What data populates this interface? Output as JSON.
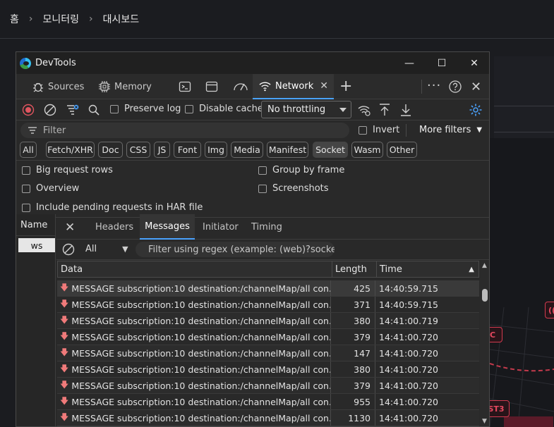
{
  "breadcrumb": {
    "home": "홈",
    "section": "모니터링",
    "page": "대시보드",
    "separator": "›"
  },
  "background_nodes": [
    {
      "label": "C"
    },
    {
      "label": "(("
    },
    {
      "label": "ST3"
    }
  ],
  "devtools": {
    "window_title": "DevTools",
    "window_buttons": {
      "minimize": "—",
      "maximize": "☐",
      "close": "✕"
    },
    "tabs": [
      {
        "label": "Sources"
      },
      {
        "label": "Memory"
      },
      {
        "label": "Network",
        "active": true
      }
    ],
    "toolbar": {
      "preserve_log": "Preserve log",
      "disable_cache": "Disable cache",
      "throttling": "No throttling"
    },
    "filter": {
      "placeholder": "Filter",
      "invert": "Invert",
      "more_filters": "More filters"
    },
    "chips": [
      "All",
      "Fetch/XHR",
      "Doc",
      "CSS",
      "JS",
      "Font",
      "Img",
      "Media",
      "Manifest",
      "Socket",
      "Wasm",
      "Other"
    ],
    "active_chip": "Socket",
    "options": {
      "big_request_rows": "Big request rows",
      "group_by_frame": "Group by frame",
      "overview": "Overview",
      "screenshots": "Screenshots",
      "include_pending": "Include pending requests in HAR file"
    },
    "name_column": {
      "header": "Name",
      "item": "ws"
    },
    "detail_tabs": [
      {
        "label": "Headers"
      },
      {
        "label": "Messages",
        "active": true
      },
      {
        "label": "Initiator"
      },
      {
        "label": "Timing"
      }
    ],
    "message_filter": {
      "type": "All",
      "regex_placeholder": "Filter using regex (example: (web)?socket"
    },
    "table": {
      "headers": {
        "data": "Data",
        "length": "Length",
        "time": "Time"
      },
      "rows": [
        {
          "data": "MESSAGE subscription:10 destination:/channelMap/all con...",
          "length": "425",
          "time": "14:40:59.715"
        },
        {
          "data": "MESSAGE subscription:10 destination:/channelMap/all con...",
          "length": "371",
          "time": "14:40:59.715"
        },
        {
          "data": "MESSAGE subscription:10 destination:/channelMap/all con...",
          "length": "380",
          "time": "14:41:00.719"
        },
        {
          "data": "MESSAGE subscription:10 destination:/channelMap/all con...",
          "length": "379",
          "time": "14:41:00.720"
        },
        {
          "data": "MESSAGE subscription:10 destination:/channelMap/all con...",
          "length": "147",
          "time": "14:41:00.720"
        },
        {
          "data": "MESSAGE subscription:10 destination:/channelMap/all con...",
          "length": "380",
          "time": "14:41:00.720"
        },
        {
          "data": "MESSAGE subscription:10 destination:/channelMap/all con...",
          "length": "379",
          "time": "14:41:00.720"
        },
        {
          "data": "MESSAGE subscription:10 destination:/channelMap/all con...",
          "length": "955",
          "time": "14:41:00.720"
        },
        {
          "data": "MESSAGE subscription:10 destination:/channelMap/all con...",
          "length": "1130",
          "time": "14:41:00.720"
        }
      ]
    }
  },
  "colors": {
    "accent": "#4aa3ff",
    "record": "#e0555f",
    "incoming_arrow": "#f07a7a",
    "node": "#d33a4f"
  }
}
